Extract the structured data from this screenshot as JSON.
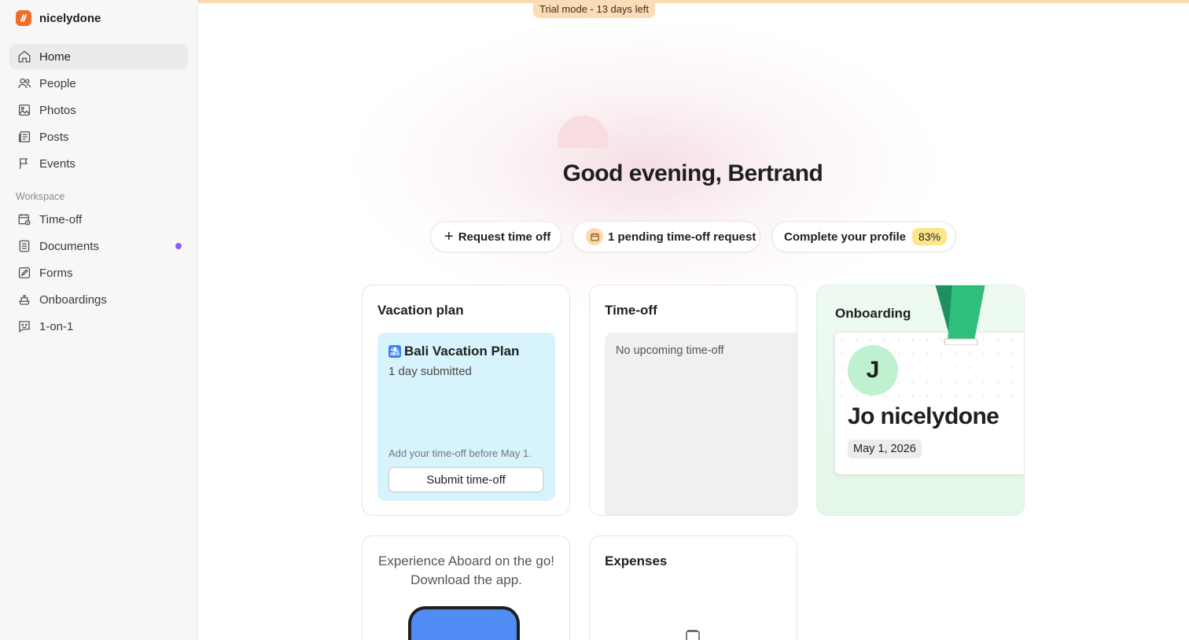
{
  "app": {
    "name": "nicelydone",
    "brand_color": "#f26b2a"
  },
  "sidebar": {
    "items": [
      {
        "label": "Home",
        "icon": "home-icon",
        "active": true
      },
      {
        "label": "People",
        "icon": "people-icon"
      },
      {
        "label": "Photos",
        "icon": "photo-icon"
      },
      {
        "label": "Posts",
        "icon": "posts-icon"
      },
      {
        "label": "Events",
        "icon": "flag-icon"
      }
    ],
    "workspace_label": "Workspace",
    "workspace_items": [
      {
        "label": "Time-off",
        "icon": "calendar-clock-icon"
      },
      {
        "label": "Documents",
        "icon": "document-icon",
        "has_notification": true
      },
      {
        "label": "Forms",
        "icon": "form-icon"
      },
      {
        "label": "Onboardings",
        "icon": "onboarding-icon"
      },
      {
        "label": "1-on-1",
        "icon": "chat-face-icon"
      }
    ]
  },
  "banner": {
    "trial_text": "Trial mode - 13 days left"
  },
  "greeting": "Good evening, Bertrand",
  "actions": {
    "request_time_off": "Request time off",
    "pending_request": "1 pending time-off request",
    "complete_profile": "Complete your profile",
    "profile_percent": "83%"
  },
  "vacation_plan": {
    "title": "Vacation plan",
    "plan_name": "Bali Vacation Plan",
    "submitted": "1 day submitted",
    "note": "Add your time-off before May 1.",
    "submit_label": "Submit time-off"
  },
  "time_off": {
    "title": "Time-off",
    "empty_text": "No upcoming time-off"
  },
  "onboarding": {
    "title": "Onboarding",
    "initial": "J",
    "name": "Jo nicelydone",
    "date": "May 1, 2026"
  },
  "app_promo": {
    "line1": "Experience Aboard on the go!",
    "line2": "Download the app."
  },
  "expenses": {
    "title": "Expenses"
  }
}
